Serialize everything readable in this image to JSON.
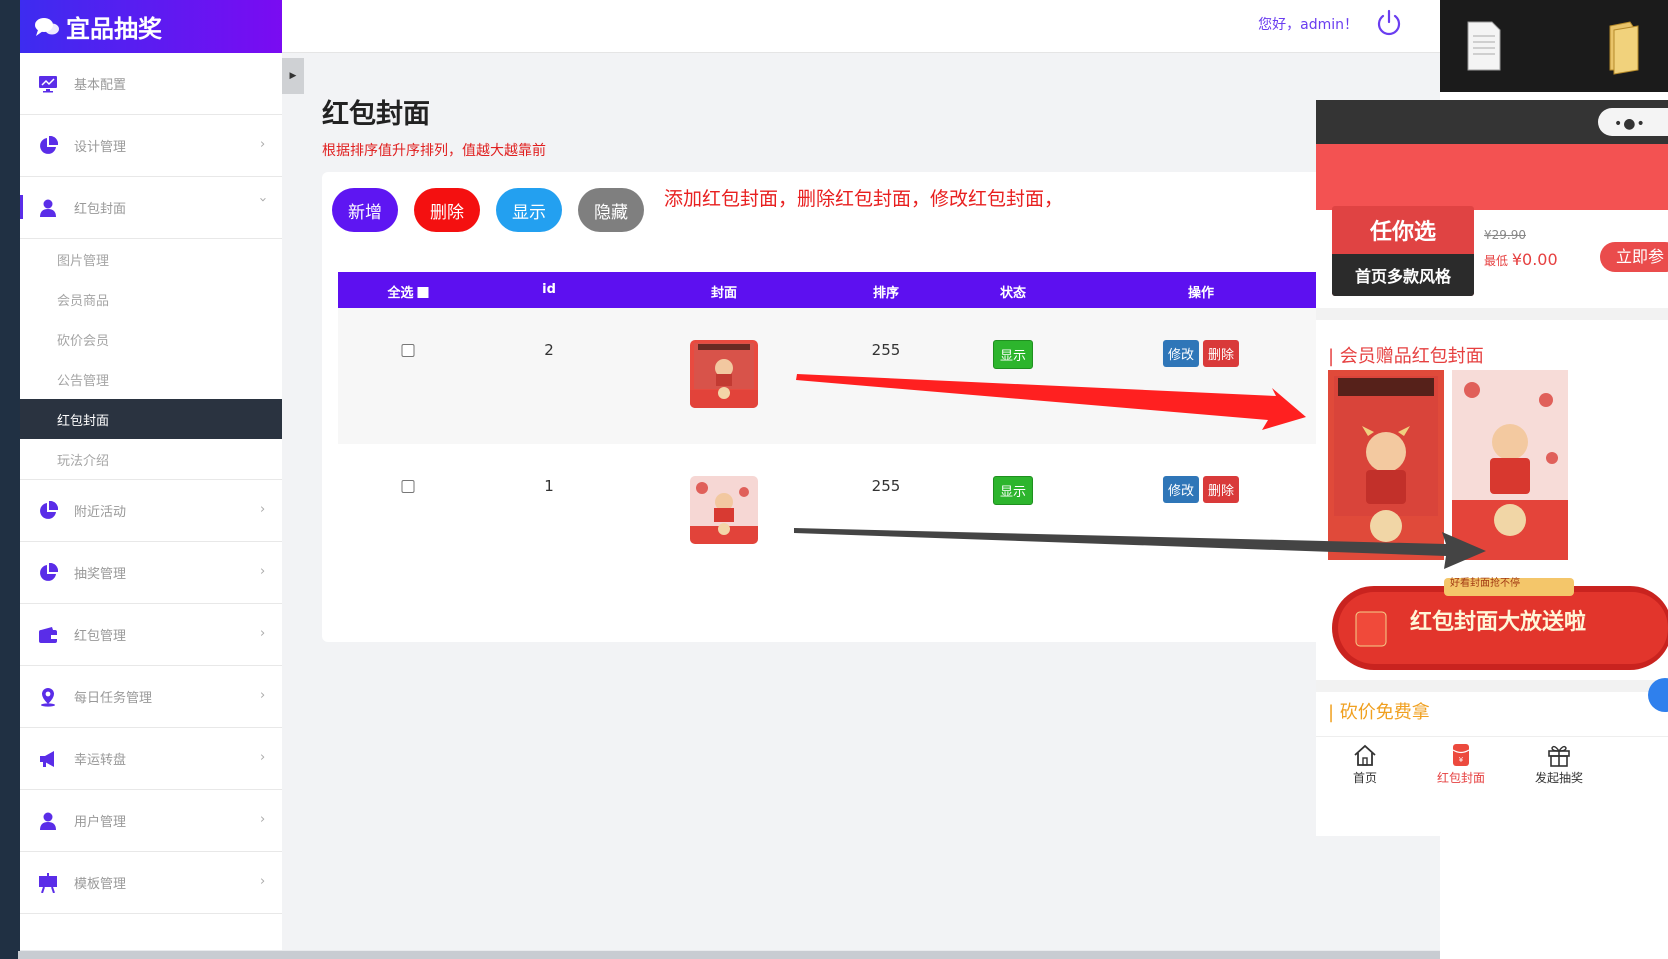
{
  "brand": {
    "name": "宜品抽奖"
  },
  "topbar": {
    "greeting": "您好，admin！"
  },
  "sidebar": {
    "items": [
      {
        "label": "基本配置"
      },
      {
        "label": "设计管理"
      },
      {
        "label": "红包封面"
      },
      {
        "label": "附近活动"
      },
      {
        "label": "抽奖管理"
      },
      {
        "label": "红包管理"
      },
      {
        "label": "每日任务管理"
      },
      {
        "label": "幸运转盘"
      },
      {
        "label": "用户管理"
      },
      {
        "label": "模板管理"
      }
    ],
    "sub_items": [
      {
        "label": "图片管理"
      },
      {
        "label": "会员商品"
      },
      {
        "label": "砍价会员"
      },
      {
        "label": "公告管理"
      },
      {
        "label": "红包封面"
      },
      {
        "label": "玩法介绍"
      }
    ]
  },
  "page": {
    "title": "红包封面",
    "subtitle": "根据排序值升序排列，值越大越靠前",
    "annotation": "添加红包封面，删除红包封面，修改红包封面，"
  },
  "toolbar": {
    "add": "新增",
    "delete": "删除",
    "show": "显示",
    "hide": "隐藏"
  },
  "table": {
    "headers": {
      "select_all": "全选",
      "id": "id",
      "cover": "封面",
      "sort": "排序",
      "status": "状态",
      "action": "操作"
    },
    "rows": [
      {
        "id": "2",
        "sort": "255",
        "status": "显示",
        "edit": "修改",
        "delete": "删除"
      },
      {
        "id": "1",
        "sort": "255",
        "status": "显示",
        "edit": "修改",
        "delete": "删除"
      }
    ]
  },
  "phone": {
    "product_title": "任你选",
    "product_subtitle": "首页多款风格",
    "old_price": "¥29.90",
    "price_prefix": "最低",
    "price": "¥0.00",
    "join_btn": "立即参",
    "section_covers": "会员赠品红包封面",
    "section_bargain": "砍价免费拿",
    "banner_tag": "好看封面抢不停",
    "banner_text": "红包封面大放送啦",
    "tabs": [
      {
        "label": "首页"
      },
      {
        "label": "红包封面"
      },
      {
        "label": "发起抽奖"
      }
    ]
  },
  "colors": {
    "accent": "#5d10f0",
    "danger": "#f41010",
    "info": "#23a0f0",
    "muted": "#7f7f7f",
    "success": "#2db52d"
  }
}
